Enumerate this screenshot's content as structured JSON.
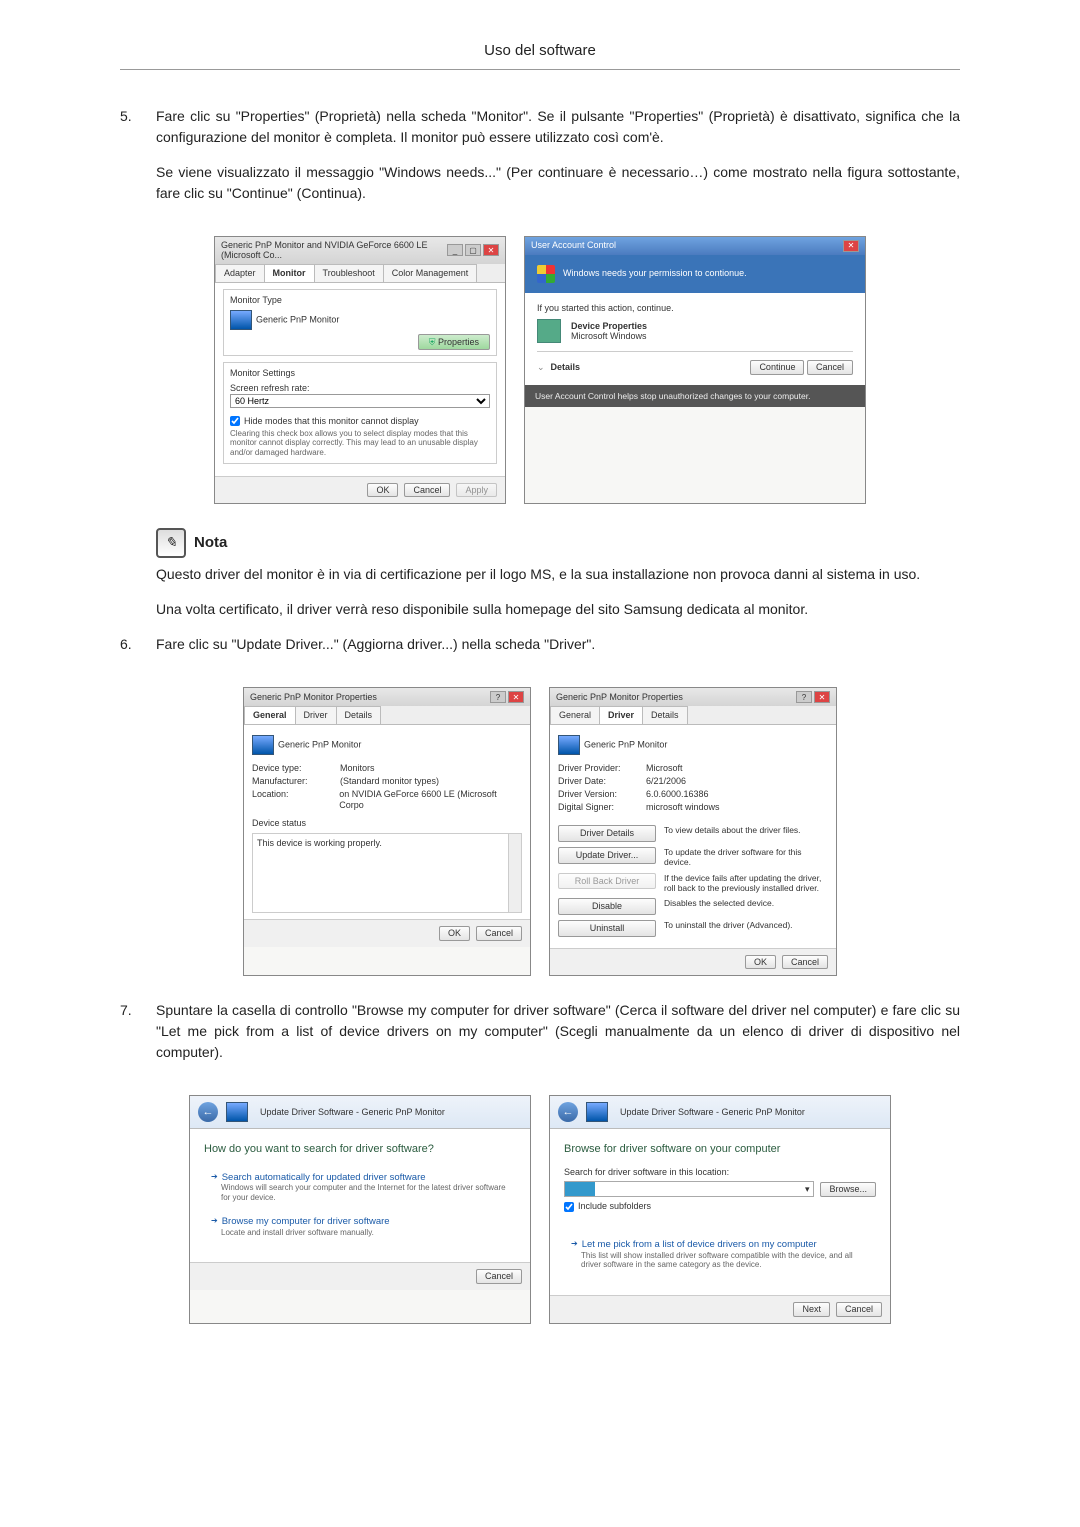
{
  "page_header": "Uso del software",
  "step5": {
    "num": "5.",
    "p1": "Fare clic su \"Properties\" (Proprietà) nella scheda \"Monitor\". Se il pulsante \"Properties\" (Proprietà) è disattivato, significa che la configurazione del monitor è completa. Il monitor può essere utilizzato così com'è.",
    "p2": "Se viene visualizzato il messaggio \"Windows needs...\" (Per continuare è necessario…) come mostrato nella figura sottostante, fare clic su \"Continue\" (Continua)."
  },
  "win_monitor": {
    "title": "Generic PnP Monitor and NVIDIA GeForce 6600 LE (Microsoft Co...",
    "tabs": [
      "Adapter",
      "Monitor",
      "Troubleshoot",
      "Color Management"
    ],
    "section1": "Monitor Type",
    "monitor_name": "Generic PnP Monitor",
    "properties_btn": "Properties",
    "section2": "Monitor Settings",
    "refresh_label": "Screen refresh rate:",
    "refresh_value": "60 Hertz",
    "hide_modes": "Hide modes that this monitor cannot display",
    "hide_desc": "Clearing this check box allows you to select display modes that this monitor cannot display correctly. This may lead to an unusable display and/or damaged hardware.",
    "ok": "OK",
    "cancel": "Cancel",
    "apply": "Apply"
  },
  "uac": {
    "title": "User Account Control",
    "headline": "Windows needs your permission to contionue.",
    "if_started": "If you started this action, continue.",
    "dev_props": "Device Properties",
    "ms_win": "Microsoft Windows",
    "details": "Details",
    "continue": "Continue",
    "cancel": "Cancel",
    "footer": "User Account Control helps stop unauthorized changes to your computer."
  },
  "note_label": "Nota",
  "note": {
    "p1": "Questo driver del monitor è in via di certificazione per il logo MS, e la sua installazione non provoca danni al sistema in uso.",
    "p2": "Una volta certificato, il driver verrà reso disponibile sulla homepage del sito Samsung dedicata al monitor."
  },
  "step6": {
    "num": "6.",
    "text": "Fare clic su \"Update Driver...\" (Aggiorna driver...) nella scheda \"Driver\"."
  },
  "props_general": {
    "title": "Generic PnP Monitor Properties",
    "tabs": [
      "General",
      "Driver",
      "Details"
    ],
    "name": "Generic PnP Monitor",
    "rows": {
      "device_type_k": "Device type:",
      "device_type_v": "Monitors",
      "manufacturer_k": "Manufacturer:",
      "manufacturer_v": "(Standard monitor types)",
      "location_k": "Location:",
      "location_v": "on NVIDIA GeForce 6600 LE (Microsoft Corpo"
    },
    "status_label": "Device status",
    "status_text": "This device is working properly.",
    "ok": "OK",
    "cancel": "Cancel"
  },
  "props_driver": {
    "title": "Generic PnP Monitor Properties",
    "tabs": [
      "General",
      "Driver",
      "Details"
    ],
    "name": "Generic PnP Monitor",
    "rows": {
      "provider_k": "Driver Provider:",
      "provider_v": "Microsoft",
      "date_k": "Driver Date:",
      "date_v": "6/21/2006",
      "version_k": "Driver Version:",
      "version_v": "6.0.6000.16386",
      "signer_k": "Digital Signer:",
      "signer_v": "microsoft windows"
    },
    "buttons": {
      "details": "Driver Details",
      "details_d": "To view details about the driver files.",
      "update": "Update Driver...",
      "update_d": "To update the driver software for this device.",
      "rollback": "Roll Back Driver",
      "rollback_d": "If the device fails after updating the driver, roll back to the previously installed driver.",
      "disable": "Disable",
      "disable_d": "Disables the selected device.",
      "uninstall": "Uninstall",
      "uninstall_d": "To uninstall the driver (Advanced)."
    },
    "ok": "OK",
    "cancel": "Cancel"
  },
  "step7": {
    "num": "7.",
    "text": "Spuntare la casella di controllo \"Browse my computer for driver software\" (Cerca il software del driver nel computer) e fare clic su \"Let me pick from a list of device drivers on my computer\" (Scegli manualmente da un elenco di driver di dispositivo nel computer)."
  },
  "wiz1": {
    "breadcrumb": "Update Driver Software - Generic PnP Monitor",
    "heading": "How do you want to search for driver software?",
    "opt1_t": "Search automatically for updated driver software",
    "opt1_d": "Windows will search your computer and the Internet for the latest driver software for your device.",
    "opt2_t": "Browse my computer for driver software",
    "opt2_d": "Locate and install driver software manually.",
    "cancel": "Cancel"
  },
  "wiz2": {
    "breadcrumb": "Update Driver Software - Generic PnP Monitor",
    "heading": "Browse for driver software on your computer",
    "search_label": "Search for driver software in this location:",
    "browse": "Browse...",
    "include": "Include subfolders",
    "opt_t": "Let me pick from a list of device drivers on my computer",
    "opt_d": "This list will show installed driver software compatible with the device, and all driver software in the same category as the device.",
    "next": "Next",
    "cancel": "Cancel"
  }
}
